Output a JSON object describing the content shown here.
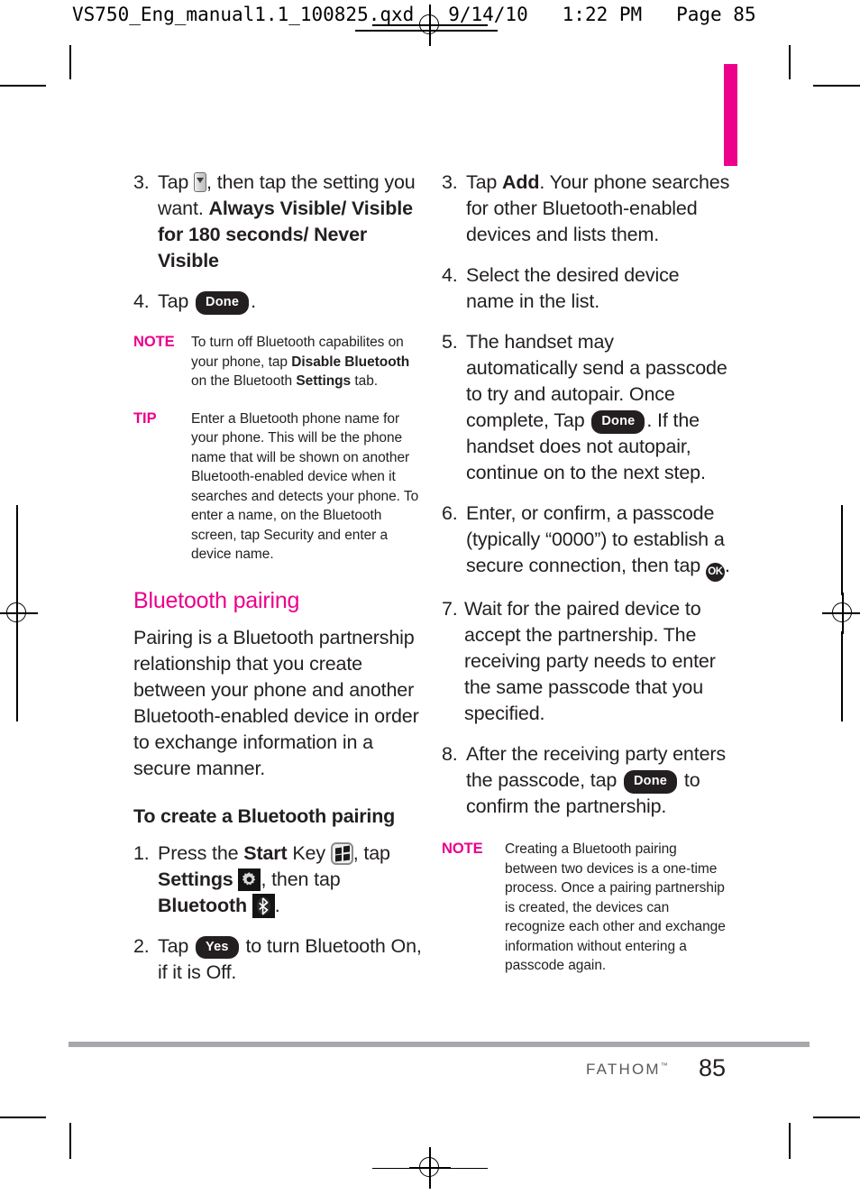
{
  "slug": {
    "text": "VS750_Eng_manual1.1_100825.qxd   9/14/10   1:22 PM   Page 85"
  },
  "colors": {
    "accent_magenta": "#ec008c",
    "body_text": "#231f20",
    "footer_rule": "#a6a8ab",
    "footer_brand": "#58595b"
  },
  "left_column": {
    "steps": [
      {
        "number": "3.",
        "lead": "Tap",
        "icon": "dropdown-icon",
        "after_icon": ", then tap the setting you want.",
        "bold_tail": "Always Visible/ Visible for 180 seconds/ Never Visible"
      },
      {
        "number": "4.",
        "lead": "Tap",
        "pill": "Done",
        "after_pill": "."
      }
    ],
    "note": {
      "label": "NOTE",
      "part1": "To turn off Bluetooth capabilites on your phone, tap ",
      "bold1": "Disable Bluetooth",
      "part2": " on the Bluetooth ",
      "bold2": "Settings",
      "part3": " tab."
    },
    "tip": {
      "label": "TIP",
      "text": "Enter a Bluetooth phone name for your phone. This will be the phone name that will be shown on another Bluetooth-enabled device when it searches and detects your phone. To enter a name, on the Bluetooth screen, tap Security and enter a device name."
    },
    "section_heading": "Bluetooth pairing",
    "section_paragraph": "Pairing is a Bluetooth partnership relationship that you create between your phone and another Bluetooth-enabled device in order to exchange information in a secure manner.",
    "sub_heading": "To create a Bluetooth pairing",
    "pairing_steps": [
      {
        "number": "1.",
        "t1": "Press the ",
        "b1": "Start",
        "t2": " Key ",
        "icon1": "windows-start-icon",
        "t3": ", tap ",
        "b2": "Settings",
        "icon2": "gear-icon",
        "t4": ", then tap ",
        "b3": "Bluetooth",
        "icon3": "bluetooth-icon",
        "t5": "."
      },
      {
        "number": "2.",
        "t1": "Tap ",
        "pill": "Yes",
        "t2": " to turn Bluetooth On, if it is Off."
      }
    ]
  },
  "right_column": {
    "steps": [
      {
        "number": "3.",
        "t1": "Tap ",
        "b1": "Add",
        "t2": ". Your phone searches for other Bluetooth-enabled devices and lists them."
      },
      {
        "number": "4.",
        "t1": "Select the desired device name in the list."
      },
      {
        "number": "5.",
        "t1": "The handset may automatically send a passcode to try and autopair. Once complete, Tap ",
        "pill": "Done",
        "t2": ". If the handset does not autopair, continue on to the next step."
      },
      {
        "number": "6.",
        "t1": "Enter, or confirm, a passcode (typically “0000”) to establish a secure connection, then tap ",
        "ok": "OK",
        "t2": "."
      },
      {
        "number": "7.",
        "t1": "Wait for the paired device to accept the partnership. The receiving party needs to enter the same passcode that you specified."
      },
      {
        "number": "8.",
        "t1": "After the receiving party enters the passcode, tap ",
        "pill": "Done",
        "t2": " to confirm the partnership."
      }
    ],
    "note": {
      "label": "NOTE",
      "text": "Creating a Bluetooth pairing between two devices is a one-time process. Once a pairing partnership is created, the devices can recognize each other and exchange information without entering a passcode again."
    }
  },
  "footer": {
    "brand": "FATHOM",
    "brand_tm": "™",
    "page_number": "85"
  }
}
